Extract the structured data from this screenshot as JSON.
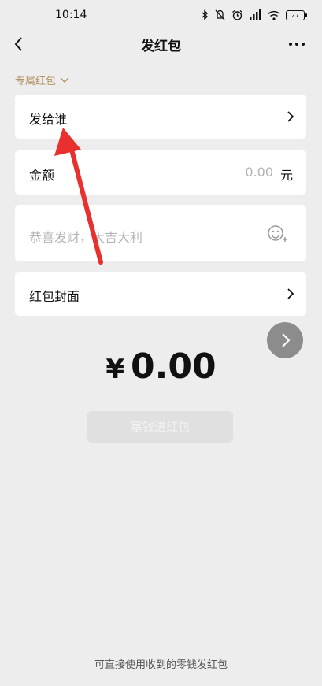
{
  "status_bar": {
    "time": "10:14",
    "battery": "27"
  },
  "nav": {
    "title": "发红包"
  },
  "packet_type": {
    "label": "专属红包"
  },
  "recipient_row": {
    "label": "发给谁"
  },
  "amount_row": {
    "label": "金额",
    "value": "0.00",
    "unit": "元"
  },
  "greeting": {
    "placeholder": "恭喜发财，大吉大利"
  },
  "cover_row": {
    "label": "红包封面"
  },
  "total": {
    "currency": "¥",
    "amount": "0.00"
  },
  "submit": {
    "label": "塞钱进红包"
  },
  "footer": {
    "note": "可直接使用收到的零钱发红包"
  },
  "colors": {
    "accent_gold": "#b49467",
    "annotation_arrow": "#e8302e",
    "background": "#ededed"
  },
  "icons": [
    "bluetooth-icon",
    "mute-icon",
    "alarm-icon",
    "hd-signal-icon",
    "wifi-icon",
    "battery-icon",
    "back-arrow-icon",
    "more-icon",
    "chevron-down-icon",
    "chevron-right-icon",
    "emoji-add-icon",
    "next-arrow-icon"
  ]
}
